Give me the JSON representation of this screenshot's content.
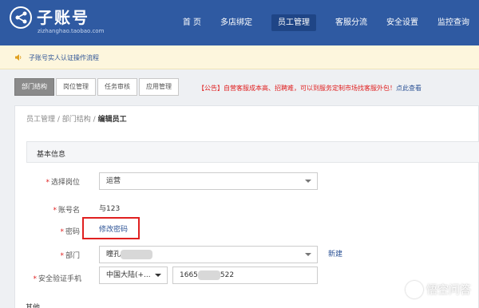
{
  "header": {
    "brand": "子账号",
    "brand_sub": "zizhanghao.taobao.com",
    "nav": [
      "首 页",
      "多店绑定",
      "员工管理",
      "客服分流",
      "安全设置",
      "监控查询"
    ],
    "active_nav": "员工管理"
  },
  "notice": {
    "text": "子账号实人认证操作流程"
  },
  "tabs": [
    "部门结构",
    "岗位管理",
    "任务审核",
    "应用管理"
  ],
  "announcement": {
    "text": "【公告】自营客服成本高、招聘难，可以到服务定制市场找客服外包！",
    "link": "点此查看"
  },
  "breadcrumb": {
    "part1": "员工管理",
    "sep": " / ",
    "part2": "部门结构",
    "current": "编辑员工"
  },
  "section_title": "基本信息",
  "form": {
    "position_label": "选择岗位",
    "position_value": "运营",
    "account_label": "账号名",
    "account_value": "与123",
    "password_label": "密码",
    "password_link": "修改密码",
    "dept_label": "部门",
    "dept_value": "曈孔",
    "dept_new": "新建",
    "phone_label": "安全验证手机",
    "phone_region": "中国大陆(+...",
    "phone_prefix": "1665",
    "phone_suffix": "522"
  },
  "other_title": "其他",
  "watermark": "悟空问答",
  "colors": {
    "header_bg": "#2f5aa2",
    "accent": "#2d5396",
    "required": "#e02020"
  }
}
